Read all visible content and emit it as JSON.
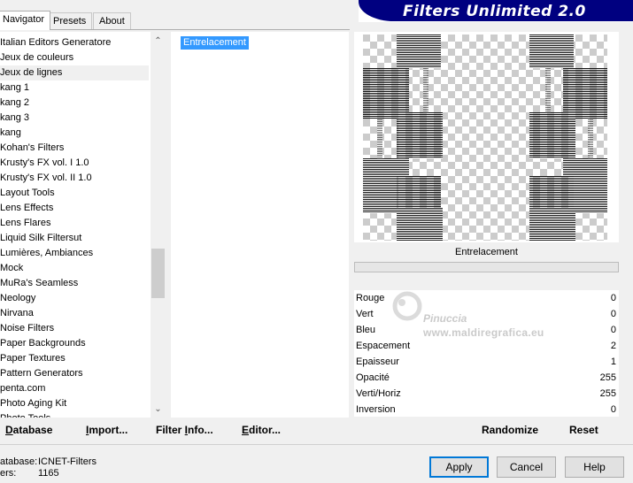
{
  "tabs": [
    {
      "label": "Navigator",
      "active": true
    },
    {
      "label": "Presets",
      "active": false
    },
    {
      "label": "About",
      "active": false
    }
  ],
  "banner": {
    "title": "Filters Unlimited 2.0",
    "color": "#000080"
  },
  "categories": [
    "Italian Editors Generatore",
    "Jeux de couleurs",
    "Jeux de lignes",
    "kang 1",
    "kang 2",
    "kang 3",
    "kang",
    "Kohan's Filters",
    "Krusty's FX vol. I 1.0",
    "Krusty's FX vol. II 1.0",
    "Layout Tools",
    "Lens Effects",
    "Lens Flares",
    "Liquid Silk Filtersut",
    "Lumières, Ambiances",
    "Mock",
    "MuRa's Seamless",
    "Neology",
    "Nirvana",
    "Noise Filters",
    "Paper Backgrounds",
    "Paper Textures",
    "Pattern Generators",
    "penta.com",
    "Photo Aging Kit",
    "Photo Tools"
  ],
  "selected_category": "Jeux de lignes",
  "filters": [
    "Entrelacement"
  ],
  "selected_filter": "Entrelacement",
  "preview": {
    "filter_name": "Entrelacement"
  },
  "params": [
    {
      "label": "Rouge",
      "value": "0"
    },
    {
      "label": "Vert",
      "value": "0"
    },
    {
      "label": "Bleu",
      "value": "0"
    },
    {
      "label": "Espacement",
      "value": "2"
    },
    {
      "label": "Epaisseur",
      "value": "1"
    },
    {
      "label": "Opacité",
      "value": "255"
    },
    {
      "label": "Verti/Horiz",
      "value": "255"
    },
    {
      "label": "Inversion",
      "value": "0"
    }
  ],
  "watermark": {
    "name": "Pinuccia",
    "url": "www.maldiregrafica.eu"
  },
  "toolbar": {
    "database": {
      "label": "Database",
      "underline": "D",
      "rest": "atabase"
    },
    "import": {
      "label": "Import...",
      "underline": "I",
      "rest": "mport..."
    },
    "filter_info": {
      "label": "Filter Info...",
      "pre": "Filter ",
      "underline": "I",
      "rest": "nfo..."
    },
    "editor": {
      "label": "Editor...",
      "underline": "E",
      "rest": "ditor..."
    },
    "randomize": "Randomize",
    "reset": "Reset"
  },
  "status": {
    "database_label": "atabase:",
    "database_value": "ICNET-Filters",
    "filters_label": "ers:",
    "filters_value": "1165"
  },
  "buttons": {
    "apply": "Apply",
    "cancel": "Cancel",
    "help": "Help"
  },
  "colors": {
    "selection": "#3399ff",
    "default_button_border": "#0078d7"
  }
}
